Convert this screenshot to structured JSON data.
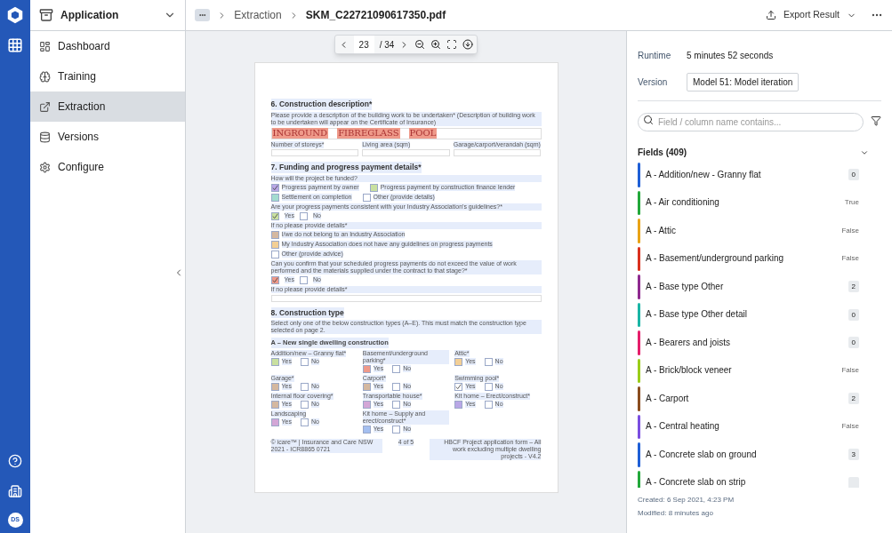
{
  "app": {
    "title": "Application"
  },
  "nav": [
    {
      "label": "Dashboard",
      "selected": false
    },
    {
      "label": "Training",
      "selected": false
    },
    {
      "label": "Extraction",
      "selected": true
    },
    {
      "label": "Versions",
      "selected": false
    },
    {
      "label": "Configure",
      "selected": false
    }
  ],
  "rail": {
    "avatar": "DS"
  },
  "breadcrumb": {
    "more": "•••",
    "parent": "Extraction",
    "current": "SKM_C22721090617350.pdf"
  },
  "export": {
    "label": "Export Result"
  },
  "viewer": {
    "page": "23",
    "total": "/ 34"
  },
  "document": {
    "items": [
      {
        "kind": "heading",
        "text": "6. Construction description*"
      },
      {
        "kind": "text",
        "text": "Please provide a description of the building work to be undertaken* (Description of building work to be undertaken will appear on the Certificate of Insurance)"
      },
      {
        "kind": "handwriting",
        "color": "#ef9a8a",
        "words": [
          "INGROUND",
          "FIBREGLASS",
          "POOL"
        ]
      },
      {
        "kind": "fields",
        "labels": [
          "Number of storeys*",
          "Living area (sqm)",
          "Garage/carport/verandah (sqm)"
        ]
      },
      {
        "kind": "heading",
        "text": "7. Funding and progress payment details*"
      },
      {
        "kind": "text",
        "text": "How will the project be funded?"
      },
      {
        "kind": "options",
        "options": [
          {
            "label": "Progress payment by owner",
            "color": "#b9a7e6",
            "checked": true
          },
          {
            "label": "Progress payment by construction finance lender",
            "color": "#c9e0a0",
            "checked": false
          }
        ]
      },
      {
        "kind": "options",
        "options": [
          {
            "label": "Settlement on completion",
            "color": "#a3dccf",
            "checked": false
          },
          {
            "label": "Other (provide details)",
            "color": "#ffffff",
            "checked": false
          }
        ]
      },
      {
        "kind": "text",
        "text": "Are your progress payments consistent with your Industry Association's guidelines?*"
      },
      {
        "kind": "yesno",
        "yes": "Yes",
        "no": "No",
        "color": "#c9e0a0",
        "checked": true,
        "no_checked": false
      },
      {
        "kind": "text",
        "text": "If no please provide details*"
      },
      {
        "kind": "options",
        "options": [
          {
            "label": "I/we do not belong to an Industry Association",
            "color": "#d4b8a0",
            "checked": false
          }
        ]
      },
      {
        "kind": "options",
        "options": [
          {
            "label": "My Industry Association does not have any guidelines on progress payments",
            "color": "#f3cf95",
            "checked": false
          }
        ]
      },
      {
        "kind": "options",
        "options": [
          {
            "label": "Other (provide advice)",
            "color": "#ffffff",
            "checked": false
          }
        ]
      },
      {
        "kind": "text",
        "text": "Can you confirm that your scheduled progress payments do not exceed the value of work performed and the materials supplied under the contract to that stage?*"
      },
      {
        "kind": "yesno",
        "yes": "Yes",
        "no": "No",
        "color": "#ef9a8a",
        "checked": true,
        "no_checked": false
      },
      {
        "kind": "text",
        "text": "If no please provide details*"
      },
      {
        "kind": "box"
      },
      {
        "kind": "heading",
        "text": "8. Construction type"
      },
      {
        "kind": "text",
        "text": "Select only one of the below construction types (A–E). This must match the construction type selected on page 2."
      },
      {
        "kind": "subheading",
        "text": "A – New single dwelling construction"
      },
      {
        "kind": "grid",
        "cells": [
          {
            "label": "Addition/new – Granny flat*",
            "color": "#c9e0a0",
            "checked": false,
            "yes": "Yes",
            "no": "No",
            "no_checked": false
          },
          {
            "label": "Basement/underground parking*",
            "color": "#ef9a8a",
            "checked": false,
            "yes": "Yes",
            "no": "No",
            "no_checked": false
          },
          {
            "label": "Attic*",
            "color": "#f3cf95",
            "checked": false,
            "yes": "Yes",
            "no": "No",
            "no_checked": false
          },
          {
            "label": "Garage*",
            "color": "#d4b8a0",
            "checked": false,
            "yes": "Yes",
            "no": "No",
            "no_checked": false
          },
          {
            "label": "Carport*",
            "color": "#d4b8a0",
            "checked": false,
            "yes": "Yes",
            "no": "No",
            "no_checked": false
          },
          {
            "label": "Swimming pool*",
            "color": "#ffffff",
            "checked": true,
            "yes": "Yes",
            "no": "No",
            "no_checked": false
          },
          {
            "label": "Internal floor covering*",
            "color": "#d4b8a0",
            "checked": false,
            "yes": "Yes",
            "no": "No",
            "no_checked": false
          },
          {
            "label": "Transportable house*",
            "color": "#d3a6d6",
            "checked": false,
            "yes": "Yes",
            "no": "No",
            "no_checked": false
          },
          {
            "label": "Kit home – Erect/construct*",
            "color": "#b9a7e6",
            "checked": false,
            "yes": "Yes",
            "no": "No",
            "no_checked": false
          },
          {
            "label": "Landscaping",
            "color": "#d3a6d6",
            "checked": false,
            "yes": "Yes",
            "no": "No",
            "no_checked": false
          },
          {
            "label": "Kit home – Supply and erect/construct*",
            "color": "#a4bff0",
            "checked": false,
            "yes": "Yes",
            "no": "No",
            "no_checked": false
          }
        ]
      },
      {
        "kind": "footer",
        "left": "© icare™ | Insurance and Care NSW 2021 - ICR8865 0721",
        "middle": "4 of 5",
        "right": "HBCF Project application form – All work excluding multiple dwelling projects - V4.2"
      }
    ]
  },
  "details": [
    {
      "label": "Runtime",
      "value": "5 minutes 52 seconds",
      "kind": "text"
    },
    {
      "label": "Version",
      "value": "Model 51: Model iteration",
      "kind": "button"
    }
  ],
  "search": {
    "placeholder": "Field / column name contains..."
  },
  "fields": {
    "title": "Fields (409)",
    "expanded": true,
    "items": [
      {
        "label": "A - Addition/new - Granny flat",
        "value": "0",
        "kind": "count",
        "color": "#1f5fd6"
      },
      {
        "label": "A - Air conditioning",
        "value": "True",
        "kind": "bool",
        "color": "#22a83a"
      },
      {
        "label": "A - Attic",
        "value": "False",
        "kind": "bool",
        "color": "#e8a317"
      },
      {
        "label": "A - Basement/underground parking",
        "value": "False",
        "kind": "bool",
        "color": "#d9301e"
      },
      {
        "label": "A - Base type Other",
        "value": "2",
        "kind": "count",
        "color": "#8e2a8f"
      },
      {
        "label": "A - Base type Other detail",
        "value": "0",
        "kind": "count",
        "color": "#1ab5a5"
      },
      {
        "label": "A - Bearers and joists",
        "value": "0",
        "kind": "count",
        "color": "#e51e6a"
      },
      {
        "label": "A - Brick/block veneer",
        "value": "False",
        "kind": "bool",
        "color": "#9acd1a"
      },
      {
        "label": "A - Carport",
        "value": "2",
        "kind": "count",
        "color": "#8a4d1f"
      },
      {
        "label": "A - Central heating",
        "value": "False",
        "kind": "bool",
        "color": "#7a4ee0"
      },
      {
        "label": "A - Concrete slab on ground",
        "value": "3",
        "kind": "count",
        "color": "#1f5fd6"
      },
      {
        "label": "A - Concrete slab on strip",
        "kind": "count",
        "color": "#22a83a"
      }
    ]
  },
  "meta": [
    "Created: 6 Sep 2021, 4:23 PM",
    "Modified: 8 minutes ago"
  ]
}
